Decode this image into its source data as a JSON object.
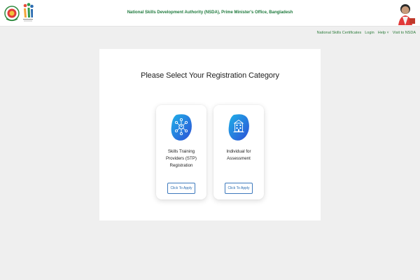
{
  "header": {
    "title": "National Skills Development Authority (NSDA), Prime Minister's Office, Bangladesh"
  },
  "nav": {
    "items": [
      "National Skills Certificates",
      "Login",
      "Help ˅",
      "Visit to NSDA"
    ]
  },
  "main": {
    "title": "Please Select Your Registration Category",
    "cards": [
      {
        "icon": "network-people-icon",
        "title_lines": [
          "Skills Training",
          "Providers (STP)",
          "Registration"
        ],
        "button_label": "Click To Apply"
      },
      {
        "icon": "building-icon",
        "title_lines": [
          "Individual for",
          "Assessment"
        ],
        "button_label": "Click To Apply"
      }
    ]
  },
  "colors": {
    "header_green": "#1f7a3d",
    "nav_green": "#2f7d3d",
    "button_blue": "#3d79bd",
    "icon_gradient_start": "#2d6ee6",
    "icon_gradient_end": "#1fb1e8"
  }
}
